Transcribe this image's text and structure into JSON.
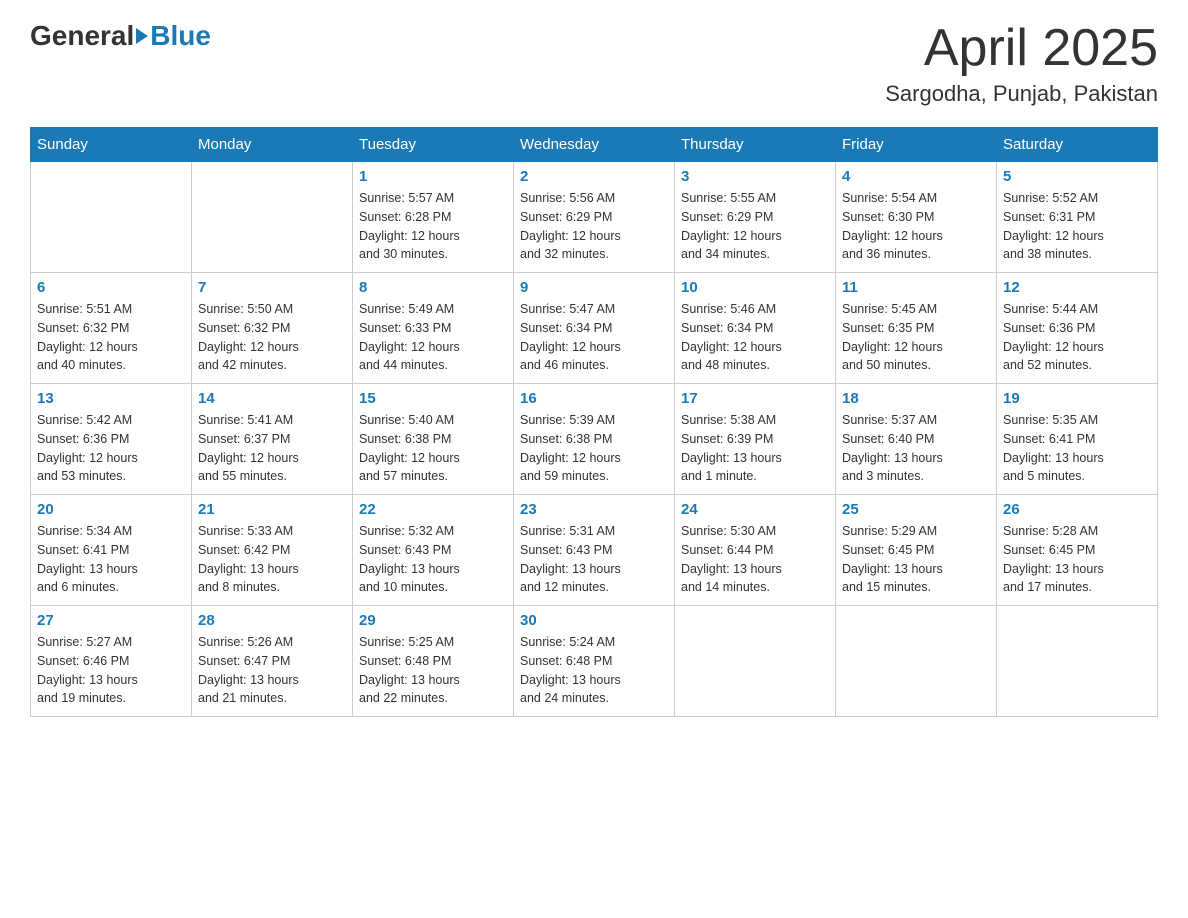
{
  "header": {
    "logo_general": "General",
    "logo_blue": "Blue",
    "month_title": "April 2025",
    "location": "Sargodha, Punjab, Pakistan"
  },
  "weekdays": [
    "Sunday",
    "Monday",
    "Tuesday",
    "Wednesday",
    "Thursday",
    "Friday",
    "Saturday"
  ],
  "weeks": [
    [
      {
        "day": "",
        "info": ""
      },
      {
        "day": "",
        "info": ""
      },
      {
        "day": "1",
        "info": "Sunrise: 5:57 AM\nSunset: 6:28 PM\nDaylight: 12 hours\nand 30 minutes."
      },
      {
        "day": "2",
        "info": "Sunrise: 5:56 AM\nSunset: 6:29 PM\nDaylight: 12 hours\nand 32 minutes."
      },
      {
        "day": "3",
        "info": "Sunrise: 5:55 AM\nSunset: 6:29 PM\nDaylight: 12 hours\nand 34 minutes."
      },
      {
        "day": "4",
        "info": "Sunrise: 5:54 AM\nSunset: 6:30 PM\nDaylight: 12 hours\nand 36 minutes."
      },
      {
        "day": "5",
        "info": "Sunrise: 5:52 AM\nSunset: 6:31 PM\nDaylight: 12 hours\nand 38 minutes."
      }
    ],
    [
      {
        "day": "6",
        "info": "Sunrise: 5:51 AM\nSunset: 6:32 PM\nDaylight: 12 hours\nand 40 minutes."
      },
      {
        "day": "7",
        "info": "Sunrise: 5:50 AM\nSunset: 6:32 PM\nDaylight: 12 hours\nand 42 minutes."
      },
      {
        "day": "8",
        "info": "Sunrise: 5:49 AM\nSunset: 6:33 PM\nDaylight: 12 hours\nand 44 minutes."
      },
      {
        "day": "9",
        "info": "Sunrise: 5:47 AM\nSunset: 6:34 PM\nDaylight: 12 hours\nand 46 minutes."
      },
      {
        "day": "10",
        "info": "Sunrise: 5:46 AM\nSunset: 6:34 PM\nDaylight: 12 hours\nand 48 minutes."
      },
      {
        "day": "11",
        "info": "Sunrise: 5:45 AM\nSunset: 6:35 PM\nDaylight: 12 hours\nand 50 minutes."
      },
      {
        "day": "12",
        "info": "Sunrise: 5:44 AM\nSunset: 6:36 PM\nDaylight: 12 hours\nand 52 minutes."
      }
    ],
    [
      {
        "day": "13",
        "info": "Sunrise: 5:42 AM\nSunset: 6:36 PM\nDaylight: 12 hours\nand 53 minutes."
      },
      {
        "day": "14",
        "info": "Sunrise: 5:41 AM\nSunset: 6:37 PM\nDaylight: 12 hours\nand 55 minutes."
      },
      {
        "day": "15",
        "info": "Sunrise: 5:40 AM\nSunset: 6:38 PM\nDaylight: 12 hours\nand 57 minutes."
      },
      {
        "day": "16",
        "info": "Sunrise: 5:39 AM\nSunset: 6:38 PM\nDaylight: 12 hours\nand 59 minutes."
      },
      {
        "day": "17",
        "info": "Sunrise: 5:38 AM\nSunset: 6:39 PM\nDaylight: 13 hours\nand 1 minute."
      },
      {
        "day": "18",
        "info": "Sunrise: 5:37 AM\nSunset: 6:40 PM\nDaylight: 13 hours\nand 3 minutes."
      },
      {
        "day": "19",
        "info": "Sunrise: 5:35 AM\nSunset: 6:41 PM\nDaylight: 13 hours\nand 5 minutes."
      }
    ],
    [
      {
        "day": "20",
        "info": "Sunrise: 5:34 AM\nSunset: 6:41 PM\nDaylight: 13 hours\nand 6 minutes."
      },
      {
        "day": "21",
        "info": "Sunrise: 5:33 AM\nSunset: 6:42 PM\nDaylight: 13 hours\nand 8 minutes."
      },
      {
        "day": "22",
        "info": "Sunrise: 5:32 AM\nSunset: 6:43 PM\nDaylight: 13 hours\nand 10 minutes."
      },
      {
        "day": "23",
        "info": "Sunrise: 5:31 AM\nSunset: 6:43 PM\nDaylight: 13 hours\nand 12 minutes."
      },
      {
        "day": "24",
        "info": "Sunrise: 5:30 AM\nSunset: 6:44 PM\nDaylight: 13 hours\nand 14 minutes."
      },
      {
        "day": "25",
        "info": "Sunrise: 5:29 AM\nSunset: 6:45 PM\nDaylight: 13 hours\nand 15 minutes."
      },
      {
        "day": "26",
        "info": "Sunrise: 5:28 AM\nSunset: 6:45 PM\nDaylight: 13 hours\nand 17 minutes."
      }
    ],
    [
      {
        "day": "27",
        "info": "Sunrise: 5:27 AM\nSunset: 6:46 PM\nDaylight: 13 hours\nand 19 minutes."
      },
      {
        "day": "28",
        "info": "Sunrise: 5:26 AM\nSunset: 6:47 PM\nDaylight: 13 hours\nand 21 minutes."
      },
      {
        "day": "29",
        "info": "Sunrise: 5:25 AM\nSunset: 6:48 PM\nDaylight: 13 hours\nand 22 minutes."
      },
      {
        "day": "30",
        "info": "Sunrise: 5:24 AM\nSunset: 6:48 PM\nDaylight: 13 hours\nand 24 minutes."
      },
      {
        "day": "",
        "info": ""
      },
      {
        "day": "",
        "info": ""
      },
      {
        "day": "",
        "info": ""
      }
    ]
  ]
}
